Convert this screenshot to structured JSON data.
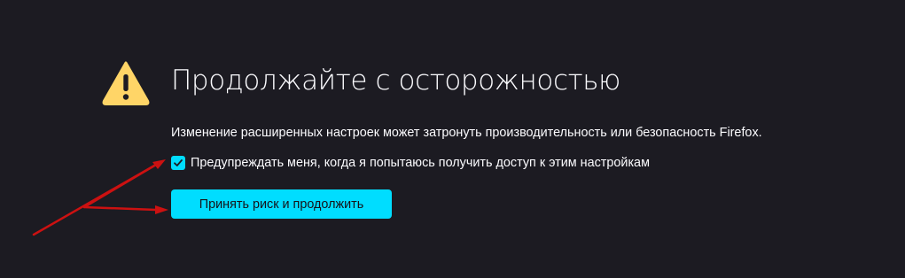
{
  "warning": {
    "title": "Продолжайте с осторожностью",
    "description": "Изменение расширенных настроек может затронуть производительность или безопасность Firefox.",
    "checkbox_label": "Предупреждать меня, когда я попытаюсь получить доступ к этим настройкам",
    "checkbox_checked": true,
    "accept_button_label": "Принять риск и продолжить"
  },
  "icons": {
    "warning": "warning-icon",
    "checkmark": "checkmark-icon"
  },
  "colors": {
    "background": "#1c1b22",
    "text": "#fbfbfe",
    "accent": "#00ddff",
    "warning": "#ffd567",
    "annotation_arrow": "#cc1111"
  }
}
